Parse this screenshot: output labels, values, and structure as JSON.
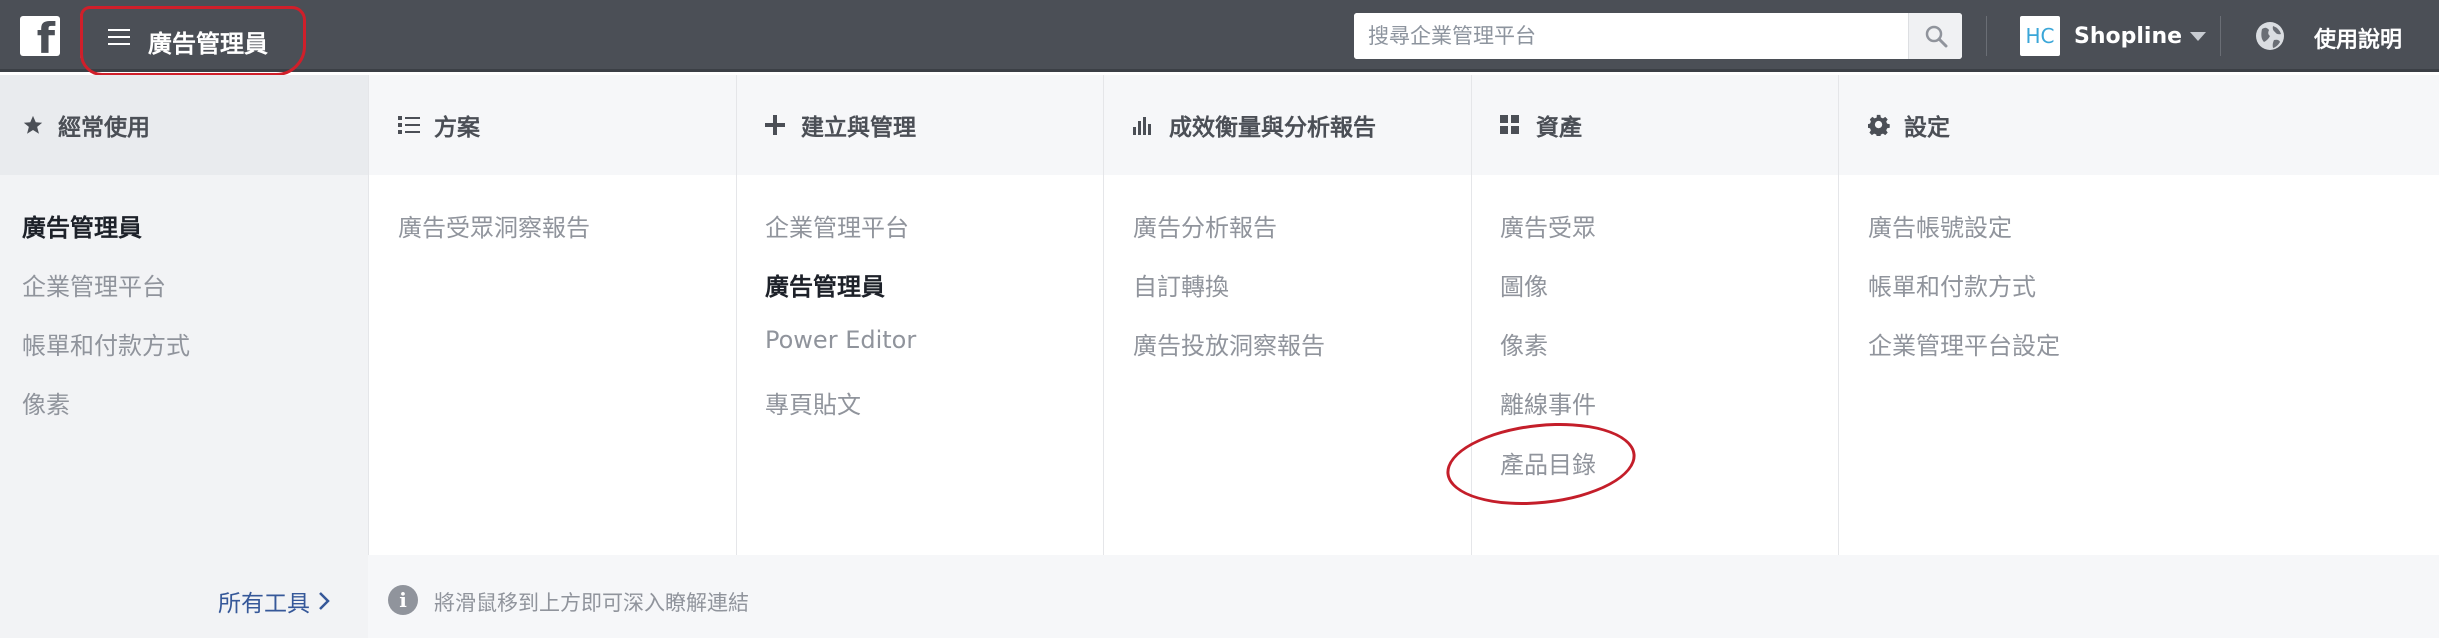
{
  "topbar": {
    "logo_letter": "f",
    "menu_title": "廣告管理員",
    "search": {
      "placeholder": "搜尋企業管理平台",
      "value": ""
    },
    "account": {
      "avatar_text": "HC",
      "name": "Shopline"
    },
    "help_label": "使用說明"
  },
  "columns": [
    {
      "title": "經常使用",
      "icon": "star-icon",
      "items": [
        "廣告管理員",
        "企業管理平台",
        "帳單和付款方式",
        "像素"
      ],
      "active_index": 0
    },
    {
      "title": "方案",
      "icon": "list-icon",
      "items": [
        "廣告受眾洞察報告"
      ]
    },
    {
      "title": "建立與管理",
      "icon": "plus-icon",
      "items": [
        "企業管理平台",
        "廣告管理員",
        "Power Editor",
        "專頁貼文"
      ],
      "active_index": 1
    },
    {
      "title": "成效衡量與分析報告",
      "icon": "bar-chart-icon",
      "items": [
        "廣告分析報告",
        "自訂轉換",
        "廣告投放洞察報告"
      ]
    },
    {
      "title": "資產",
      "icon": "grid-icon",
      "items": [
        "廣告受眾",
        "圖像",
        "像素",
        "離線事件",
        "產品目錄"
      ]
    },
    {
      "title": "設定",
      "icon": "gear-icon",
      "items": [
        "廣告帳號設定",
        "帳單和付款方式",
        "企業管理平台設定"
      ]
    }
  ],
  "footer": {
    "all_tools_label": "所有工具",
    "hint": "將滑鼠移到上方即可深入瞭解連結"
  },
  "colors": {
    "topbar": "#4b4f56",
    "link": "#365899",
    "annotation": "#d01f2a"
  }
}
